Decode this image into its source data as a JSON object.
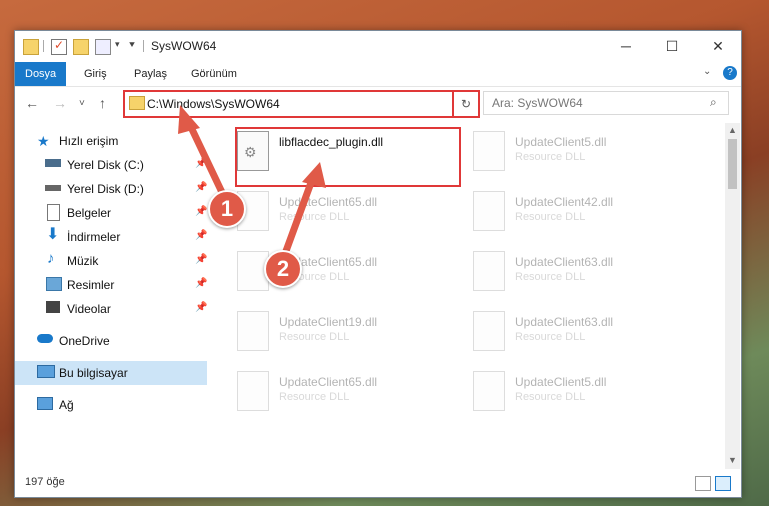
{
  "window": {
    "title": "SysWOW64"
  },
  "ribbon": {
    "tabs": [
      "Dosya",
      "Giriş",
      "Paylaş",
      "Görünüm"
    ]
  },
  "address": {
    "path": "C:\\Windows\\SysWOW64"
  },
  "search": {
    "placeholder": "Ara: SysWOW64"
  },
  "sidebar": {
    "quick_access": "Hızlı erişim",
    "items": [
      {
        "label": "Yerel Disk (C:)",
        "icon": "drive-icon"
      },
      {
        "label": "Yerel Disk (D:)",
        "icon": "drive-icon"
      },
      {
        "label": "Belgeler",
        "icon": "documents-icon"
      },
      {
        "label": "İndirmeler",
        "icon": "download-icon"
      },
      {
        "label": "Müzik",
        "icon": "music-icon"
      },
      {
        "label": "Resimler",
        "icon": "pictures-icon"
      },
      {
        "label": "Videolar",
        "icon": "videos-icon"
      }
    ],
    "onedrive": "OneDrive",
    "this_pc": "Bu bilgisayar",
    "network": "Ağ"
  },
  "files": {
    "highlighted": {
      "name": "libflacdec_plugin.dll"
    },
    "col1": [
      {
        "name": "UpdateClient65.dll",
        "sub": "Resource DLL"
      },
      {
        "name": "UpdateClient65.dll",
        "sub": "Resource DLL"
      },
      {
        "name": "UpdateClient19.dll",
        "sub": "Resource DLL"
      },
      {
        "name": "UpdateClient65.dll",
        "sub": "Resource DLL"
      }
    ],
    "col2": [
      {
        "name": "UpdateClient5.dll",
        "sub": "Resource DLL"
      },
      {
        "name": "UpdateClient42.dll",
        "sub": "Resource DLL"
      },
      {
        "name": "UpdateClient63.dll",
        "sub": "Resource DLL"
      },
      {
        "name": "UpdateClient63.dll",
        "sub": "Resource DLL"
      },
      {
        "name": "UpdateClient5.dll",
        "sub": "Resource DLL"
      }
    ]
  },
  "status": {
    "count": "197 öğe"
  },
  "annotations": {
    "step1": "1",
    "step2": "2",
    "color": "#e05a48"
  }
}
